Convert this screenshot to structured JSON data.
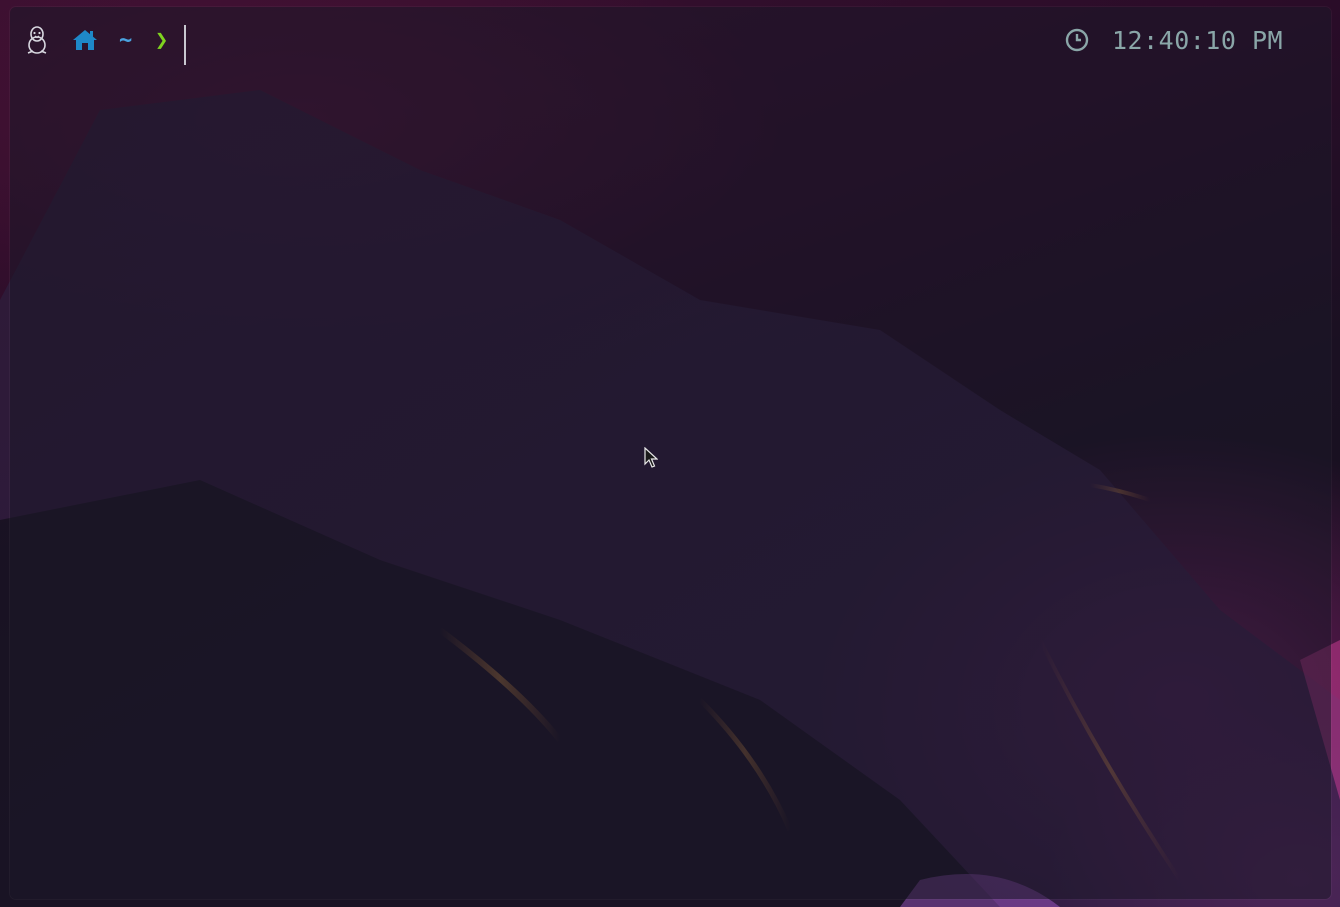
{
  "prompt": {
    "os_icon": "tux-penguin-icon",
    "home_icon": "home-icon",
    "cwd": "~",
    "chevron": "❯",
    "clock_icon": "clock-icon",
    "time": "12:40:10 PM"
  },
  "colors": {
    "home_icon": "#1e88c8",
    "cwd": "#4aa3e0",
    "chevron": "#7fd21f",
    "clock": "#8aa6a8",
    "terminal_bg": "#1c1828"
  }
}
